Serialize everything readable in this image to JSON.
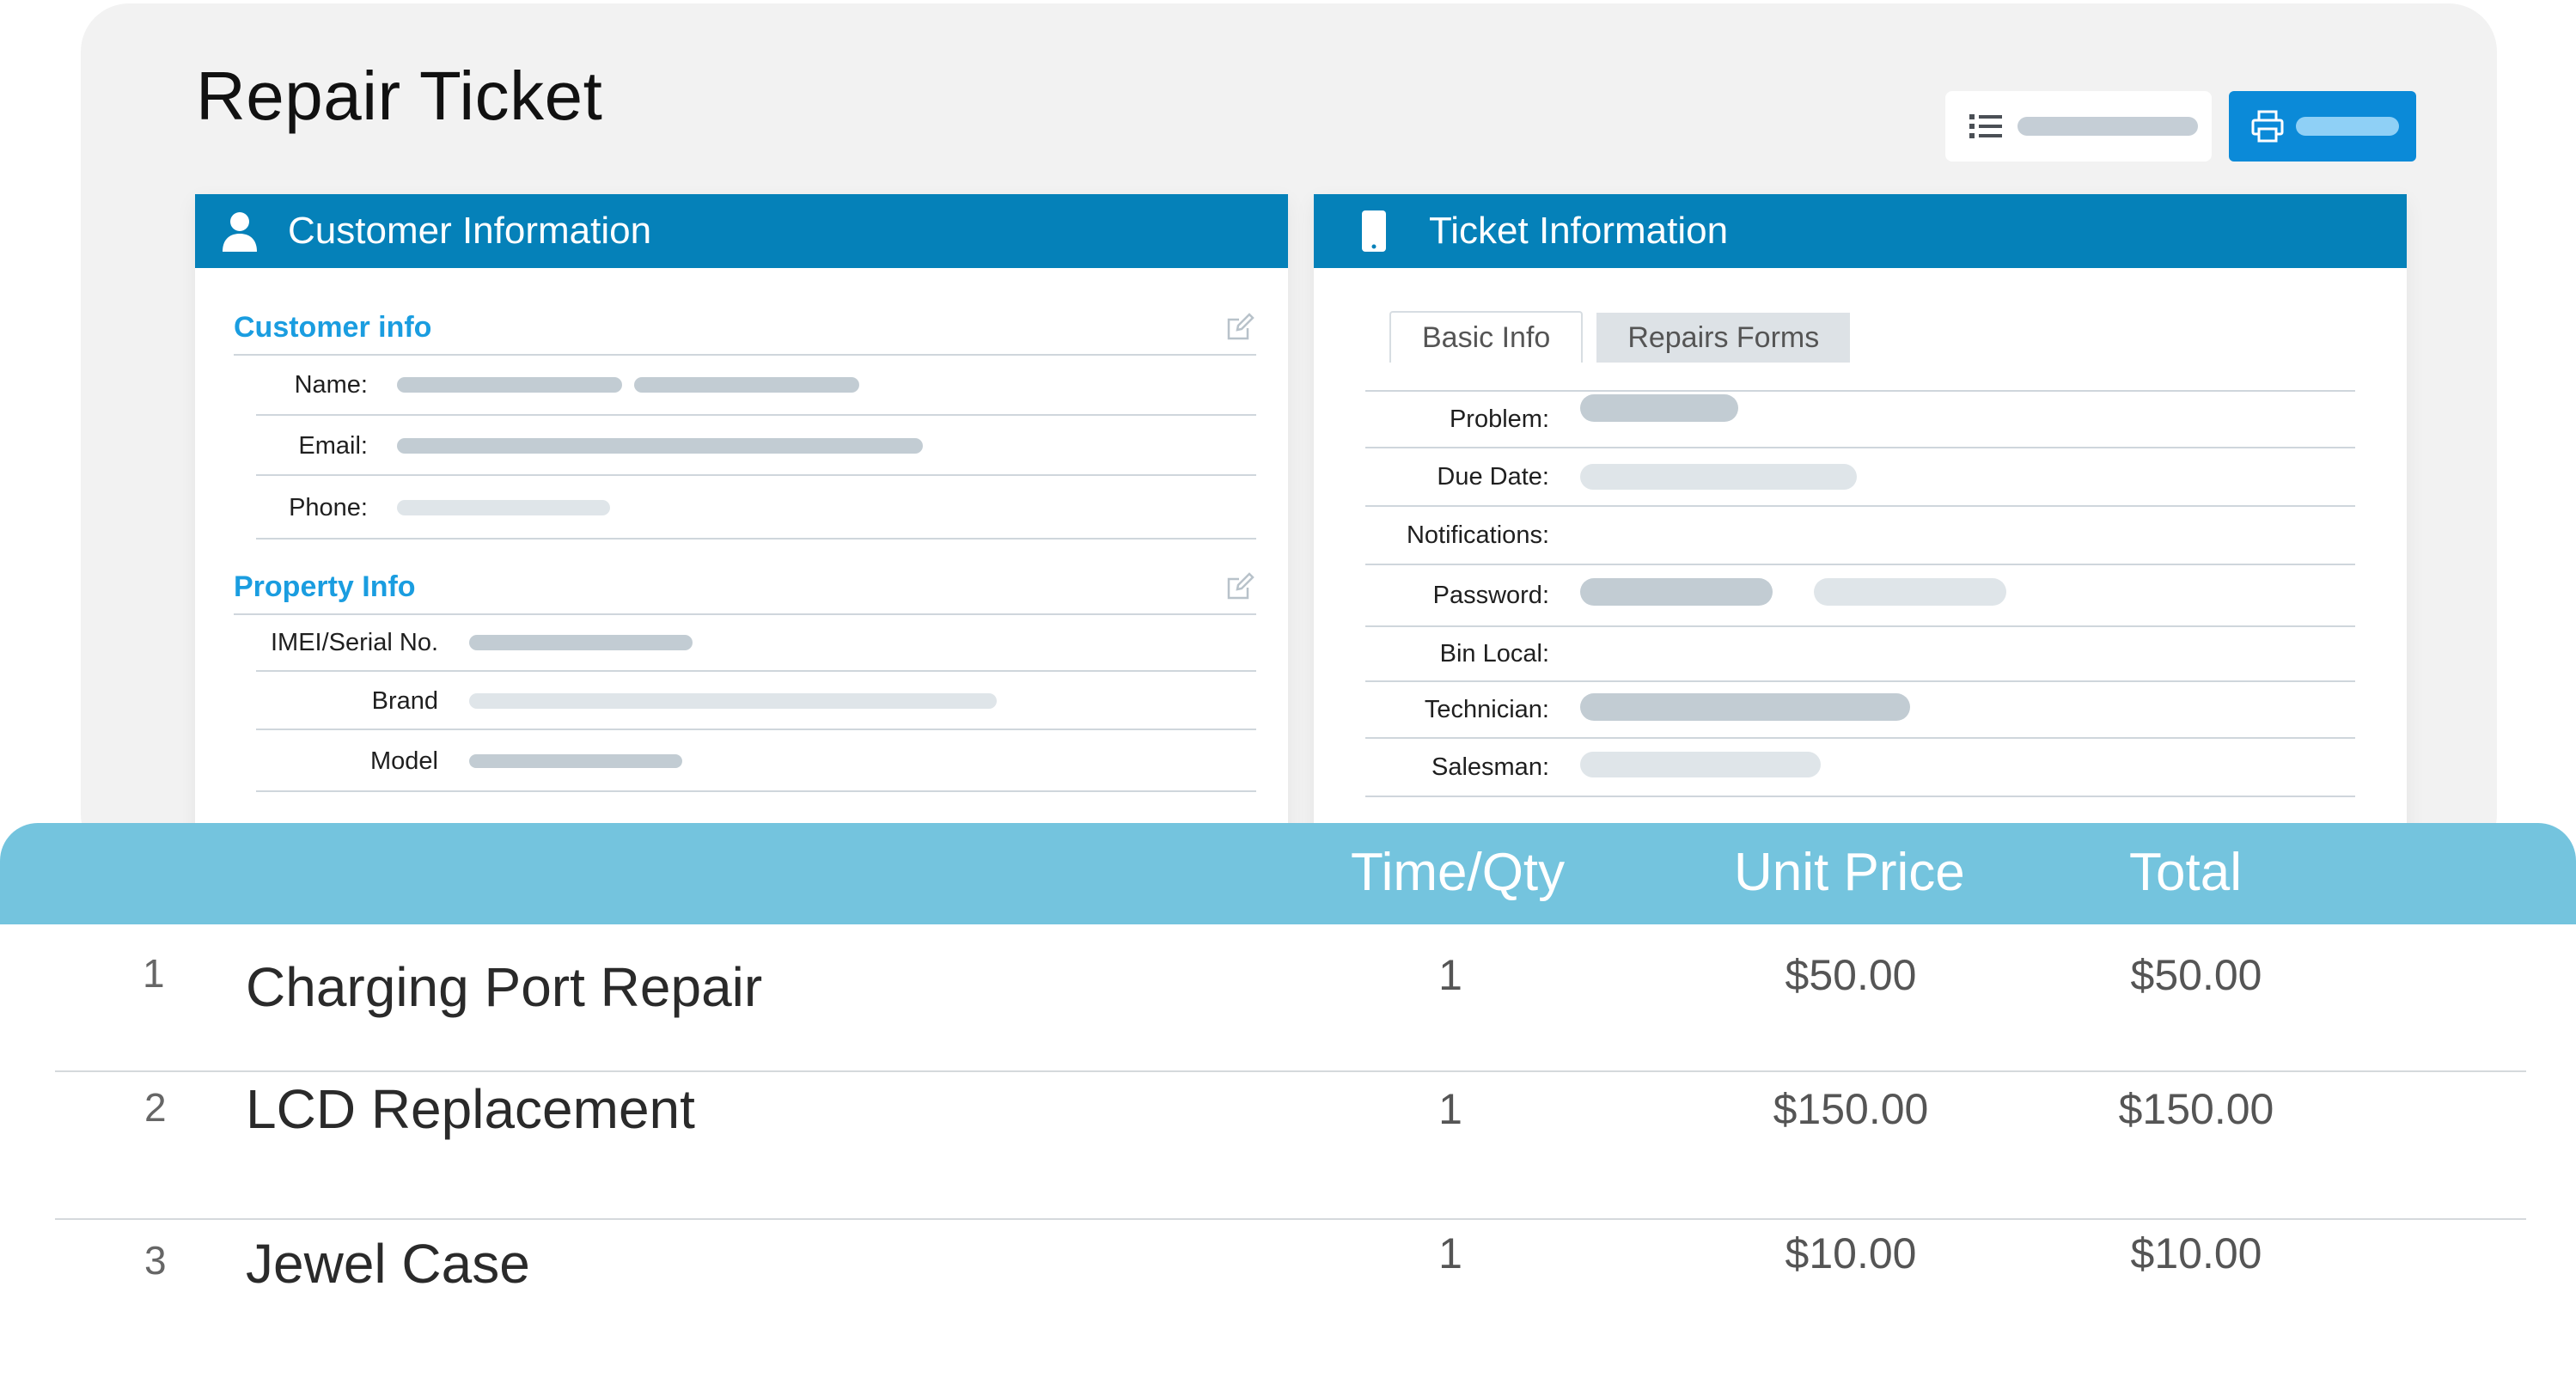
{
  "page": {
    "title": "Repair Ticket"
  },
  "toolbar": {
    "list_icon": "list-icon",
    "print_icon": "printer-icon"
  },
  "customer_panel": {
    "header": "Customer Information",
    "icon": "user-icon",
    "customer_section": {
      "title": "Customer info",
      "fields": [
        {
          "label": "Name:"
        },
        {
          "label": "Email:"
        },
        {
          "label": "Phone:"
        }
      ]
    },
    "property_section": {
      "title": "Property Info",
      "fields": [
        {
          "label": "IMEI/Serial No."
        },
        {
          "label": "Brand"
        },
        {
          "label": "Model"
        }
      ]
    }
  },
  "ticket_panel": {
    "header": "Ticket Information",
    "icon": "phone-icon",
    "tabs": [
      {
        "label": "Basic Info",
        "active": true
      },
      {
        "label": "Repairs Forms",
        "active": false
      }
    ],
    "fields": [
      {
        "label": "Problem:"
      },
      {
        "label": "Due Date:"
      },
      {
        "label": "Notifications:"
      },
      {
        "label": "Password:"
      },
      {
        "label": "Bin Local:"
      },
      {
        "label": "Technician:"
      },
      {
        "label": "Salesman:"
      }
    ]
  },
  "items_table": {
    "columns": [
      "Time/Qty",
      "Unit Price",
      "Total"
    ],
    "rows": [
      {
        "num": "1",
        "description": "Charging Port Repair",
        "qty": "1",
        "unit_price": "$50.00",
        "total": "$50.00"
      },
      {
        "num": "2",
        "description": "LCD Replacement",
        "qty": "1",
        "unit_price": "$150.00",
        "total": "$150.00"
      },
      {
        "num": "3",
        "description": "Jewel Case",
        "qty": "1",
        "unit_price": "$10.00",
        "total": "$10.00"
      }
    ]
  },
  "colors": {
    "panel_header": "#0581b9",
    "section_title": "#1a9de0",
    "table_header": "#74c4de",
    "print_button": "#0b8ad8"
  }
}
